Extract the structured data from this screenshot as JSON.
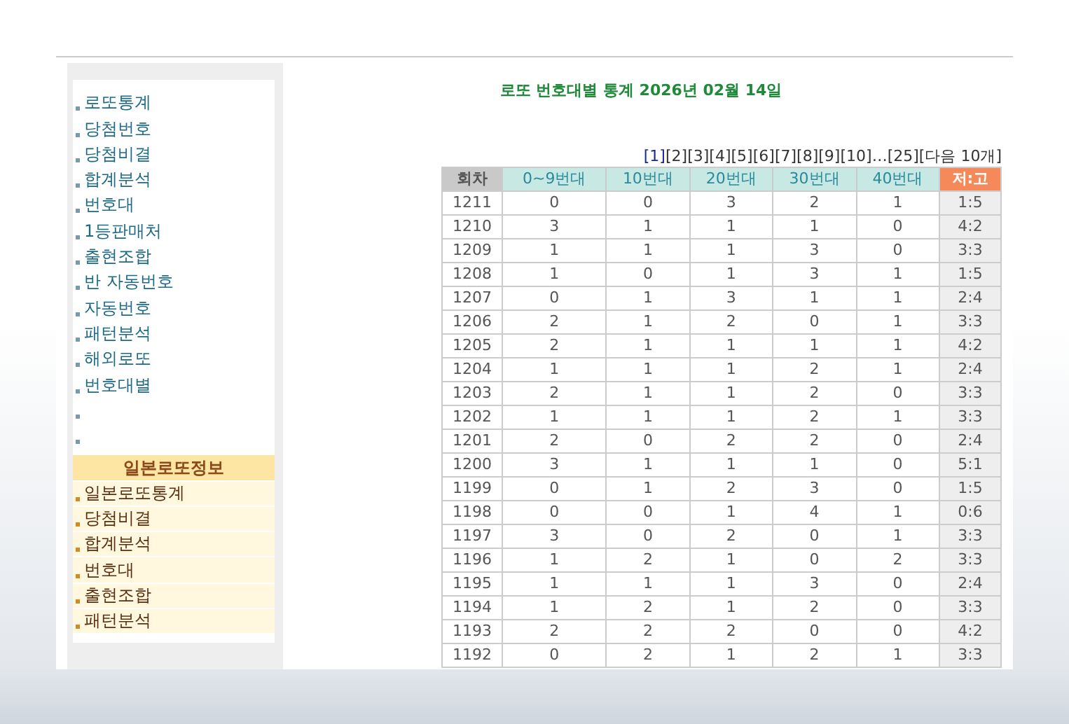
{
  "sidebar": {
    "items": [
      {
        "kind": "link",
        "label": "로또통계"
      },
      {
        "kind": "link",
        "label": "당첨번호"
      },
      {
        "kind": "link",
        "label": "당첨비결"
      },
      {
        "kind": "link",
        "label": "합계분석"
      },
      {
        "kind": "link",
        "label": "번호대"
      },
      {
        "kind": "link",
        "label": "1등판매처"
      },
      {
        "kind": "link",
        "label": "출현조합"
      },
      {
        "kind": "link",
        "label": "반 자동번호"
      },
      {
        "kind": "link",
        "label": "자동번호"
      },
      {
        "kind": "link",
        "label": "패턴분석"
      },
      {
        "kind": "link",
        "label": "해외로또"
      },
      {
        "kind": "link",
        "label": "번호대별"
      },
      {
        "kind": "blank"
      },
      {
        "kind": "blank"
      }
    ],
    "japan_section": {
      "header": "일본로또정보",
      "items": [
        "일본로또통계",
        "당첨비결",
        "합계분석",
        "번호대",
        "출현조합",
        "패턴분석"
      ]
    }
  },
  "title": "로또 번호대별 통계 2026년 02월 14일",
  "pagination": [
    {
      "kind": "page",
      "label": "[1]",
      "selected": true
    },
    {
      "kind": "page",
      "label": "[2]",
      "selected": false
    },
    {
      "kind": "page",
      "label": "[3]",
      "selected": false
    },
    {
      "kind": "page",
      "label": "[4]",
      "selected": false
    },
    {
      "kind": "page",
      "label": "[5]",
      "selected": false
    },
    {
      "kind": "page",
      "label": "[6]",
      "selected": false
    },
    {
      "kind": "page",
      "label": "[7]",
      "selected": false
    },
    {
      "kind": "page",
      "label": "[8]",
      "selected": false
    },
    {
      "kind": "page",
      "label": "[9]",
      "selected": false
    },
    {
      "kind": "page",
      "label": "[10]",
      "selected": false
    },
    {
      "kind": "ellipsis",
      "label": "…"
    },
    {
      "kind": "page",
      "label": "[25]",
      "selected": false
    },
    {
      "kind": "page",
      "label": "[다음 10개]",
      "selected": false
    }
  ],
  "table": {
    "columns": [
      {
        "kind": "round",
        "label": "회차"
      },
      {
        "kind": "band",
        "label": "0~9번대"
      },
      {
        "kind": "band",
        "label": "10번대"
      },
      {
        "kind": "band",
        "label": "20번대"
      },
      {
        "kind": "band",
        "label": "30번대"
      },
      {
        "kind": "band",
        "label": "40번대"
      },
      {
        "kind": "ratio",
        "label": "저:고"
      }
    ],
    "rows": [
      [
        "1211",
        "0",
        "0",
        "3",
        "2",
        "1",
        "1:5"
      ],
      [
        "1210",
        "3",
        "1",
        "1",
        "1",
        "0",
        "4:2"
      ],
      [
        "1209",
        "1",
        "1",
        "1",
        "3",
        "0",
        "3:3"
      ],
      [
        "1208",
        "1",
        "0",
        "1",
        "3",
        "1",
        "1:5"
      ],
      [
        "1207",
        "0",
        "1",
        "3",
        "1",
        "1",
        "2:4"
      ],
      [
        "1206",
        "2",
        "1",
        "2",
        "0",
        "1",
        "3:3"
      ],
      [
        "1205",
        "2",
        "1",
        "1",
        "1",
        "1",
        "4:2"
      ],
      [
        "1204",
        "1",
        "1",
        "1",
        "2",
        "1",
        "2:4"
      ],
      [
        "1203",
        "2",
        "1",
        "1",
        "2",
        "0",
        "3:3"
      ],
      [
        "1202",
        "1",
        "1",
        "1",
        "2",
        "1",
        "3:3"
      ],
      [
        "1201",
        "2",
        "0",
        "2",
        "2",
        "0",
        "2:4"
      ],
      [
        "1200",
        "3",
        "1",
        "1",
        "1",
        "0",
        "5:1"
      ],
      [
        "1199",
        "0",
        "1",
        "2",
        "3",
        "0",
        "1:5"
      ],
      [
        "1198",
        "0",
        "0",
        "1",
        "4",
        "1",
        "0:6"
      ],
      [
        "1197",
        "3",
        "0",
        "2",
        "0",
        "1",
        "3:3"
      ],
      [
        "1196",
        "1",
        "2",
        "1",
        "0",
        "2",
        "3:3"
      ],
      [
        "1195",
        "1",
        "1",
        "1",
        "3",
        "0",
        "2:4"
      ],
      [
        "1194",
        "1",
        "2",
        "1",
        "2",
        "0",
        "3:3"
      ],
      [
        "1193",
        "2",
        "2",
        "2",
        "0",
        "0",
        "4:2"
      ],
      [
        "1192",
        "0",
        "2",
        "1",
        "2",
        "1",
        "3:3"
      ]
    ]
  }
}
